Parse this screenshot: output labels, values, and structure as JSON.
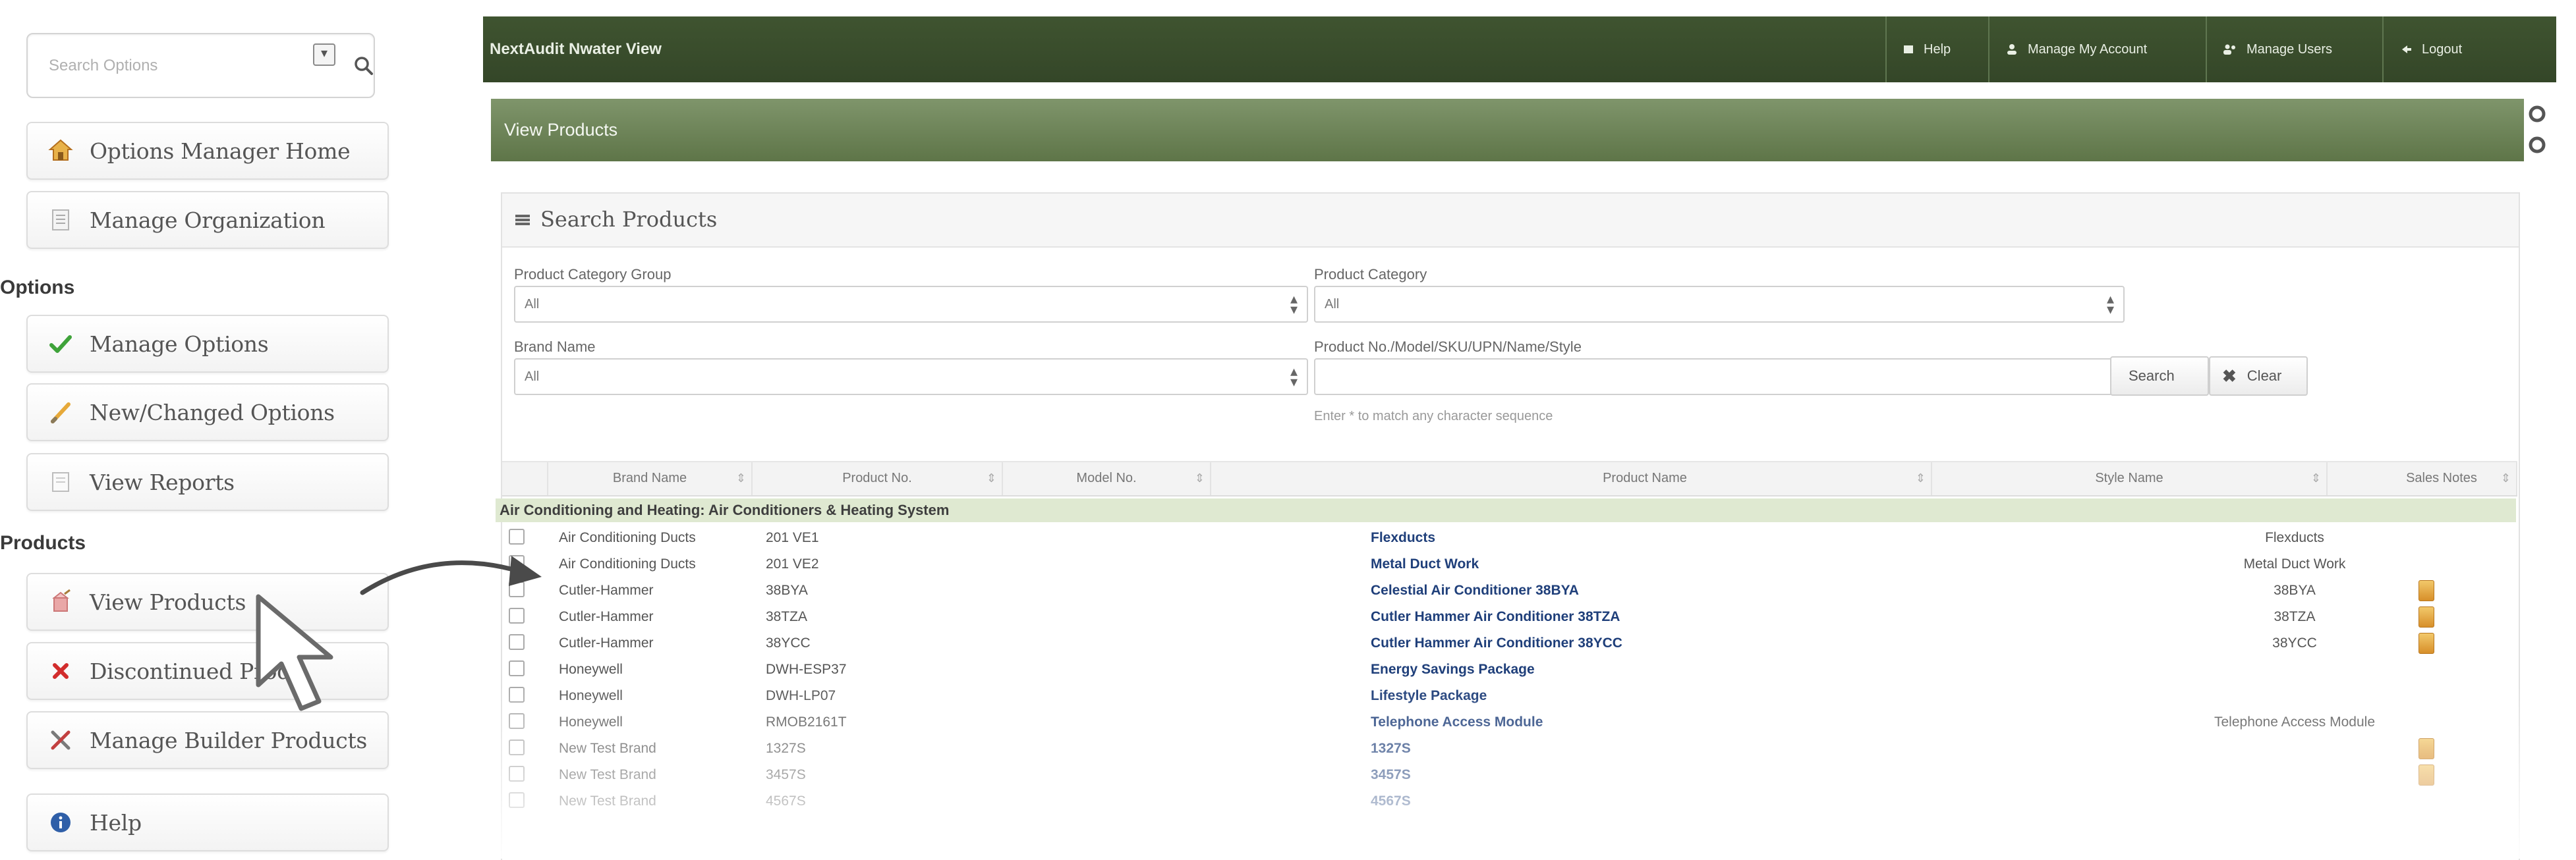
{
  "sidebar": {
    "search_placeholder": "Search Options",
    "buttons": {
      "options_manager_home": "Options Manager Home",
      "manage_organization": "Manage Organization",
      "manage_options": "Manage Options",
      "new_changed_options": "New/Changed Options",
      "view_reports": "View Reports",
      "view_products": "View Products",
      "discontinued_products": "Discontinued Prod",
      "manage_builder_products": "Manage Builder Products",
      "help": "Help"
    },
    "sections": {
      "options": "Options",
      "products": "Products"
    }
  },
  "topbar": {
    "title": "NextAudit Nwater View",
    "items": {
      "help": "Help",
      "manage_account": "Manage My Account",
      "manage_users": "Manage Users",
      "logout": "Logout"
    }
  },
  "panel": {
    "title": "View Products"
  },
  "search_products": {
    "title": "Search Products",
    "category_group_label": "Product Category Group",
    "category_group_value": "All",
    "category_label": "Product Category",
    "category_value": "All",
    "brand_label": "Brand Name",
    "brand_value": "All",
    "product_search_label": "Product No./Model/SKU/UPN/Name/Style",
    "product_search_value": "",
    "hint": "Enter * to match any character sequence",
    "search_button": "Search",
    "clear_button": "Clear"
  },
  "table": {
    "columns": {
      "brand": "Brand Name",
      "product_no": "Product No.",
      "model_no": "Model No.",
      "product_name": "Product Name",
      "style_name": "Style Name",
      "sales_notes": "Sales Notes"
    },
    "group": "Air Conditioning and Heating: Air Conditioners & Heating System",
    "rows": [
      {
        "brand": "Air Conditioning Ducts",
        "product_no": "201 VE1",
        "product_name": "Flexducts",
        "style": "Flexducts",
        "note": false
      },
      {
        "brand": "Air Conditioning Ducts",
        "product_no": "201 VE2",
        "product_name": "Metal Duct Work",
        "style": "Metal Duct Work",
        "note": false
      },
      {
        "brand": "Cutler-Hammer",
        "product_no": "38BYA",
        "product_name": "Celestial Air Conditioner 38BYA",
        "style": "38BYA",
        "note": true
      },
      {
        "brand": "Cutler-Hammer",
        "product_no": "38TZA",
        "product_name": "Cutler Hammer Air Conditioner 38TZA",
        "style": "38TZA",
        "note": true
      },
      {
        "brand": "Cutler-Hammer",
        "product_no": "38YCC",
        "product_name": "Cutler Hammer Air Conditioner 38YCC",
        "style": "38YCC",
        "note": true
      },
      {
        "brand": "Honeywell",
        "product_no": "DWH-ESP37",
        "product_name": "Energy Savings Package",
        "style": "",
        "note": false
      },
      {
        "brand": "Honeywell",
        "product_no": "DWH-LP07",
        "product_name": "Lifestyle Package",
        "style": "",
        "note": false
      },
      {
        "brand": "Honeywell",
        "product_no": "RMOB2161T",
        "product_name": "Telephone Access Module",
        "style": "Telephone Access Module",
        "note": false
      },
      {
        "brand": "New Test Brand",
        "product_no": "1327S",
        "product_name": "1327S",
        "style": "",
        "note": true
      },
      {
        "brand": "New Test Brand",
        "product_no": "3457S",
        "product_name": "3457S",
        "style": "",
        "note": true
      },
      {
        "brand": "New Test Brand",
        "product_no": "4567S",
        "product_name": "4567S",
        "style": "",
        "note": false
      }
    ]
  },
  "colors": {
    "topbar": "#3a4d2c",
    "panel_header": "#6f8659",
    "group_row": "#dfe9d1",
    "link": "#1f3f7a"
  }
}
